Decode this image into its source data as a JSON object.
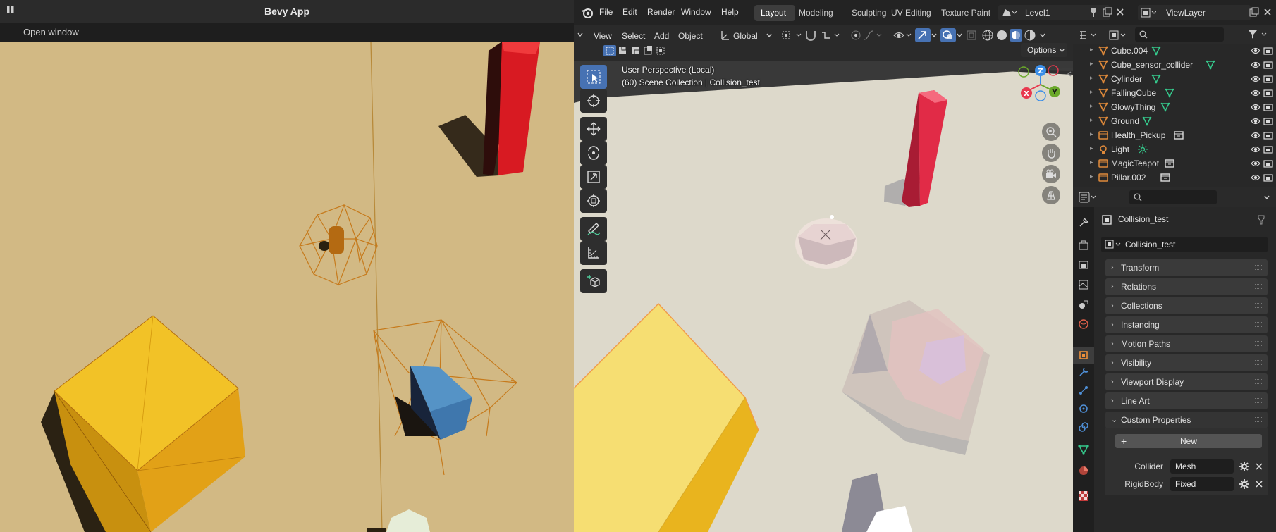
{
  "bevy": {
    "title": "Bevy App",
    "open_window_label": "Open window"
  },
  "blender": {
    "menus": [
      "File",
      "Edit",
      "Render",
      "Window",
      "Help"
    ],
    "workspaces": [
      "Layout",
      "Modeling",
      "Sculpting",
      "UV Editing",
      "Texture Paint"
    ],
    "active_workspace": "Layout",
    "scene_name": "Level1",
    "view_layer": "ViewLayer",
    "viewport_menus": [
      "View",
      "Select",
      "Add",
      "Object"
    ],
    "transform_orientation": "Global",
    "options_label": "Options",
    "viewport_info": {
      "perspective": "User Perspective (Local)",
      "collection": "(60) Scene Collection | Collision_test"
    },
    "gizmo_axes": {
      "x": "X",
      "y": "Y",
      "z": "Z"
    },
    "outliner": {
      "items": [
        {
          "name": "Cube.004",
          "type": "mesh"
        },
        {
          "name": "Cube_sensor_collider",
          "type": "mesh"
        },
        {
          "name": "Cylinder",
          "type": "mesh"
        },
        {
          "name": "FallingCube",
          "type": "mesh"
        },
        {
          "name": "GlowyThing",
          "type": "mesh"
        },
        {
          "name": "Ground",
          "type": "mesh"
        },
        {
          "name": "Health_Pickup",
          "type": "collection"
        },
        {
          "name": "Light",
          "type": "light"
        },
        {
          "name": "MagicTeapot",
          "type": "collection"
        },
        {
          "name": "Pillar.002",
          "type": "collection"
        }
      ]
    },
    "properties": {
      "object_name": "Collision_test",
      "object_field": "Collision_test",
      "panels": [
        "Transform",
        "Relations",
        "Collections",
        "Instancing",
        "Motion Paths",
        "Visibility",
        "Viewport Display",
        "Line Art"
      ],
      "custom_properties": {
        "label": "Custom Properties",
        "new_button": "New",
        "props": [
          {
            "key": "Collider",
            "value": "Mesh"
          },
          {
            "key": "RigidBody",
            "value": "Fixed"
          }
        ]
      }
    },
    "colors": {
      "accent": "#4772b3",
      "mesh_icon": "#35c98c",
      "object_icon": "#e08a3a"
    }
  }
}
